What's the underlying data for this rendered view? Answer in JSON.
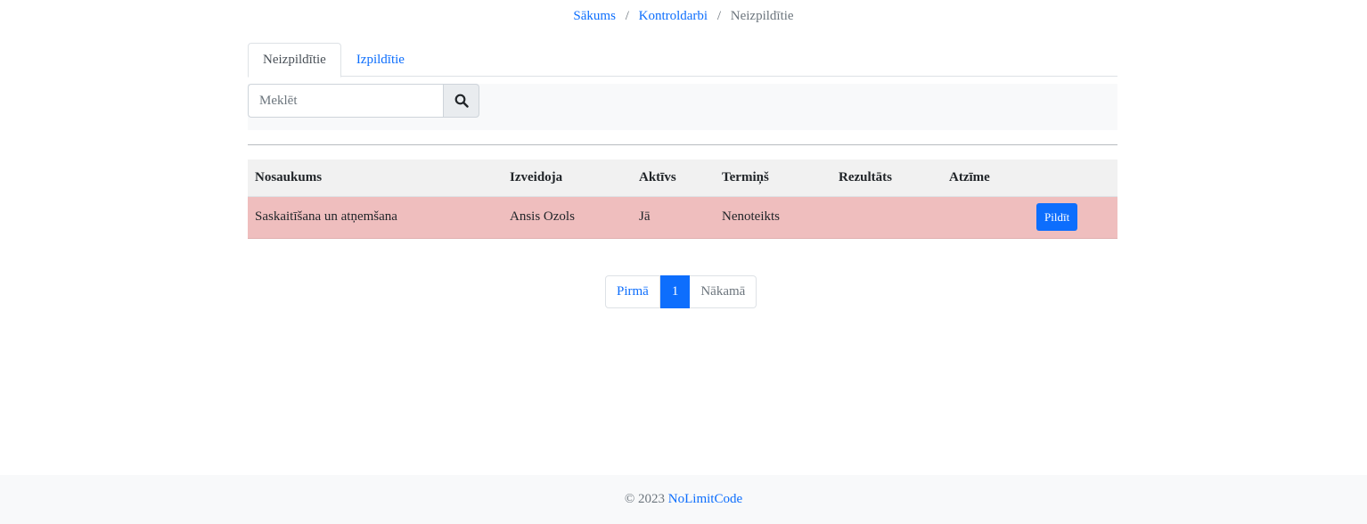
{
  "breadcrumb": {
    "home": "Sākums",
    "tests": "Kontroldarbi",
    "current": "Neizpildītie",
    "separator": "/"
  },
  "tabs": [
    {
      "label": "Neizpildītie",
      "active": true
    },
    {
      "label": "Izpildītie",
      "active": false
    }
  ],
  "search": {
    "placeholder": "Meklēt",
    "value": "",
    "icon": "search-icon"
  },
  "table": {
    "headers": [
      "Nosaukums",
      "Izveidoja",
      "Aktīvs",
      "Termiņš",
      "Rezultāts",
      "Atzīme",
      ""
    ],
    "rows": [
      {
        "name": "Saskaitīšana un atņemšana",
        "creator": "Ansis Ozols",
        "active": "Jā",
        "deadline": "Nenoteikts",
        "result": "",
        "grade": "",
        "action": "Pildīt"
      }
    ],
    "row_color": "#efbebe"
  },
  "pagination": {
    "first": "Pirmā",
    "current": "1",
    "next": "Nākamā"
  },
  "footer": {
    "copyright": "© 2023",
    "brand": "NoLimitCode"
  },
  "colors": {
    "accent": "#0d6efd",
    "muted": "#6c757d",
    "panel": "#f8f9fa"
  }
}
